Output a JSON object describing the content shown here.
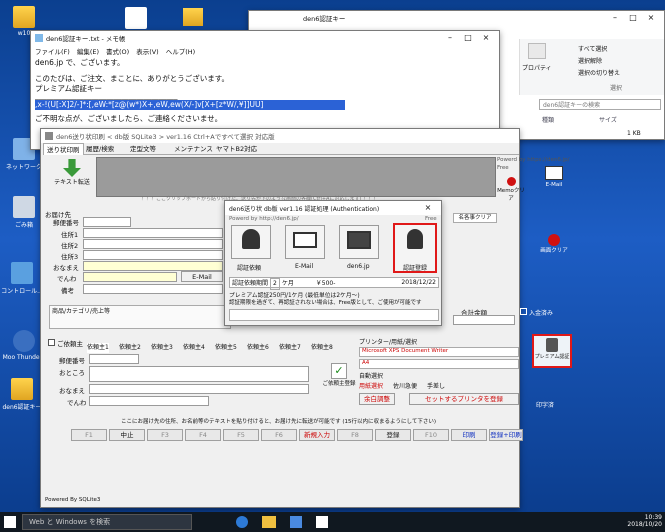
{
  "desktop": {
    "icons": [
      {
        "label": "w10"
      },
      {
        "label": "ネットワーク"
      },
      {
        "label": "ごみ箱"
      },
      {
        "label": "コントロール..."
      },
      {
        "label": "Moo Thunde..."
      },
      {
        "label": "den6認証キー"
      }
    ]
  },
  "notepad": {
    "title": "den6認証キー.txt - メモ帳",
    "menu": [
      "ファイル(F)",
      "編集(E)",
      "書式(O)",
      "表示(V)",
      "ヘルプ(H)"
    ],
    "lines": [
      "den6.jp で、ございます。",
      "このたびは、ご注文、まことに、ありがとうございます。",
      "プレミアム認証キー",
      "______________________________________",
      ",x-!(U[:X]2/-]*:[,eW:*[z@(w*)X+,eW,ew(X/-]v[X+[z*W/,¥]]UU]",
      "ご不明な点が、ございましたら、ご連絡くださいませ。"
    ]
  },
  "explorer": {
    "title": "den6認証キー",
    "ribbon": [
      "すべて選択",
      "選択解除",
      "選択の切り替え"
    ],
    "ribbon_group": "選択",
    "properties": "プロパティ",
    "search_placeholder": "den6認証キーの検索",
    "col_type": "種類",
    "col_size": "サイズ",
    "file_size": "1 KB"
  },
  "app": {
    "title": "den6送り状印刷 < db版 SQLite3 > ver1.16  Ctrl+Aですべて選択  対応版",
    "tabs": [
      "送り状印刷",
      "履歴/検索",
      "定型文等",
      "メンテナンス",
      "ヤマトB2対応"
    ],
    "text_transfer": "テキスト転送",
    "powered": "Powerd by https://den6.jp/",
    "free": "Free",
    "memo_clear": "Memoクリア",
    "email": "E-Mail",
    "notice": "！！！ここクリップボードから貼り付けた、送り先が下のような画面の各欄(Ctrl+Aに対応します) ！！！",
    "addr_title": "お届け先",
    "addr_labels": [
      "郵便番号",
      "住所1",
      "住所2",
      "住所3",
      "おなまえ",
      "でんわ",
      "備考"
    ],
    "name_clear": "名各事クリア",
    "screen_clear": "画面クリア",
    "product": "商品/カテゴリ/売上等",
    "total": "合計金額",
    "paid": "入金済み",
    "premium_label": "プレミアム認証",
    "sender": "ご依頼主",
    "sender_tabs": [
      "依頼主1",
      "依頼主2",
      "依頼主3",
      "依頼主4",
      "依頼主5",
      "依頼主6",
      "依頼主7",
      "依頼主8"
    ],
    "sender_labels": [
      "郵便番号",
      "おところ",
      "おなまえ",
      "でんわ"
    ],
    "sender_register": "ご依頼主登録",
    "printer_title": "プリンター/用紙/選択",
    "printer": "Microsoft XPS Document Writer",
    "paper": "A4",
    "auto": "自動選択",
    "paper_select": "用紙選択",
    "paper_source": "佐川急便",
    "manual": "手差し",
    "margin": "余白調整",
    "set_printer": "セットするプリンタを登録",
    "print_frame": "印字済",
    "status": "ここにお届け先の住所、お名前等のテキストを貼り付けると、お届け先に転送が可能です  (15行以内に収まるようにして下さい)",
    "fkeys": [
      "F1",
      "中止",
      "F3",
      "F4",
      "F5",
      "F6",
      "新規入力",
      "F8",
      "登録",
      "F10",
      "印刷",
      "登録+印刷"
    ],
    "footer": "Powered By SQLite3"
  },
  "dialog": {
    "title": "den6送り状 db版 ver1.16 認証処理 (Authentication)",
    "powered": "Powerd by http://den6.jp/",
    "free": "Free",
    "buttons": [
      "認証依頼",
      "E-Mail",
      "den6.jp",
      "認証登録"
    ],
    "period_label": "認証依頼期間",
    "period_value": "2",
    "period_unit": "ケ月",
    "price": "￥500-",
    "date": "2018/12/22",
    "line1": "プレミアム認証250円/1ケ月  (最低単位は2ケ月～)",
    "line2": "認証期限を過ぎて、再認証されない場合は、Free版として、ご使用が可能です"
  },
  "taskbar": {
    "search": "Web と Windows を検索",
    "time": "10:39",
    "date": "2018/10/20"
  }
}
